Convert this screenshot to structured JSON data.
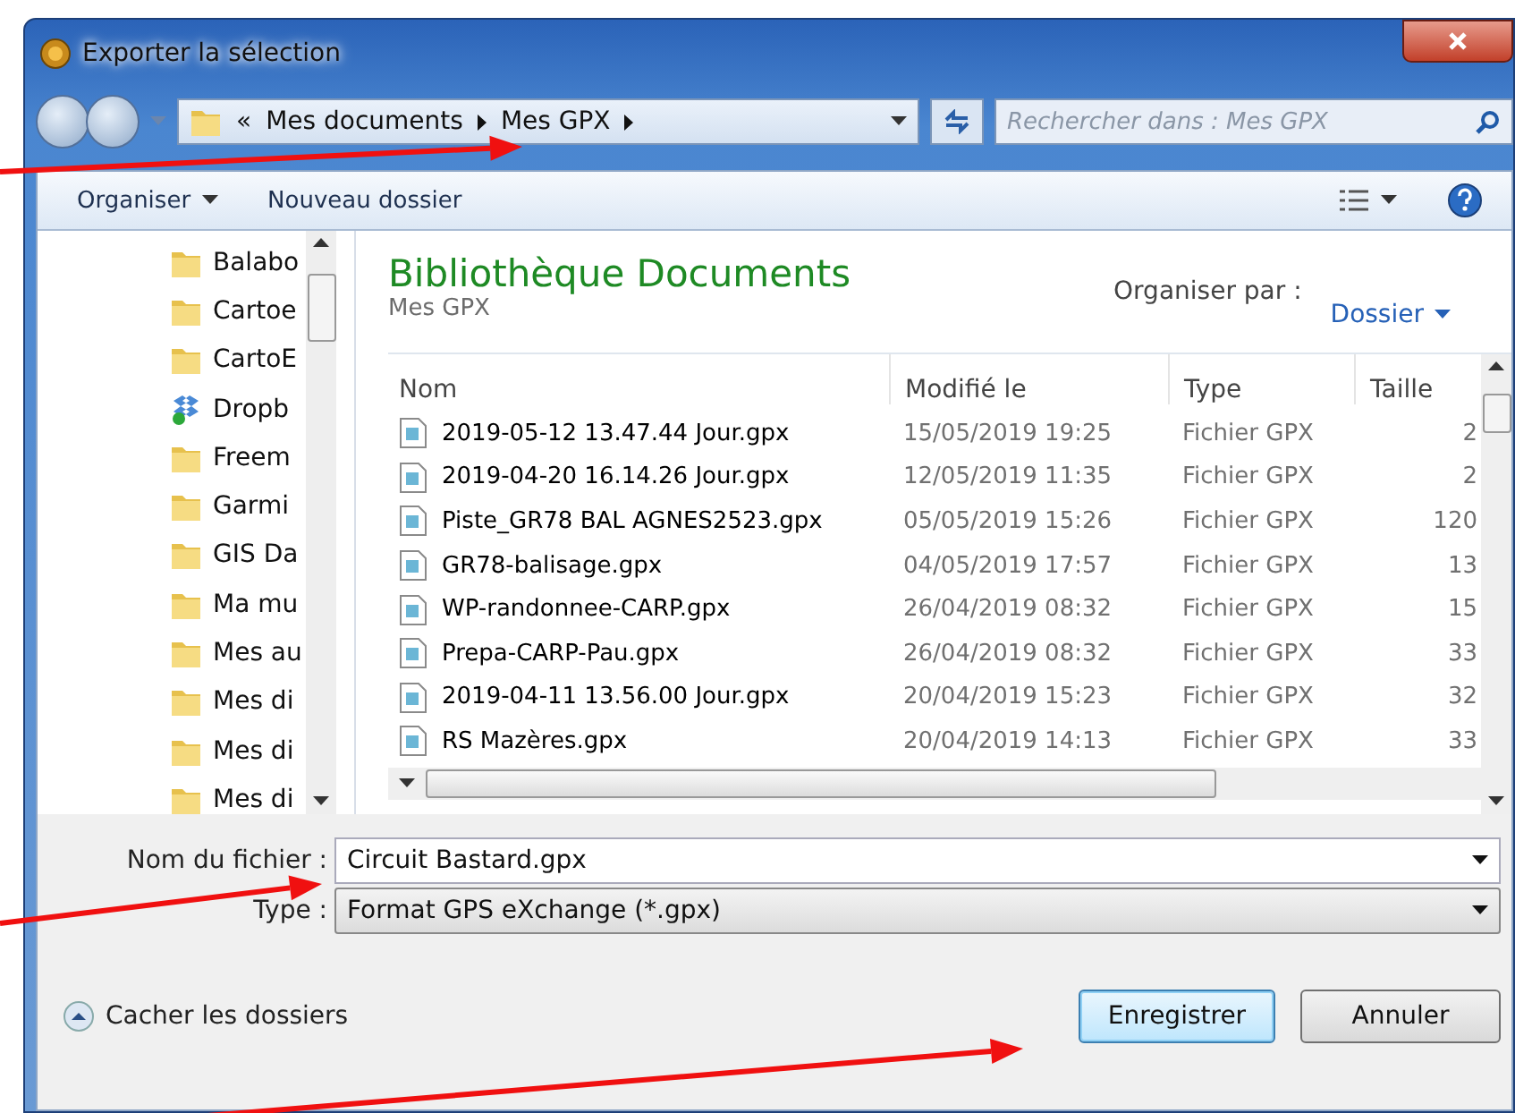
{
  "window": {
    "title": "Exporter la sélection"
  },
  "address_bar": {
    "overflow": "«",
    "crumbs": [
      "Mes documents",
      "Mes GPX"
    ],
    "search_placeholder": "Rechercher dans : Mes GPX"
  },
  "toolbar": {
    "organize": "Organiser",
    "new_folder": "Nouveau dossier"
  },
  "sidebar": {
    "items": [
      {
        "label": "Balabo",
        "kind": "folder"
      },
      {
        "label": "Cartoe",
        "kind": "folder"
      },
      {
        "label": "CartoE",
        "kind": "folder"
      },
      {
        "label": "Dropb",
        "kind": "dropbox"
      },
      {
        "label": "Freem",
        "kind": "folder"
      },
      {
        "label": "Garmi",
        "kind": "folder"
      },
      {
        "label": "GIS Da",
        "kind": "folder"
      },
      {
        "label": "Ma mu",
        "kind": "folder"
      },
      {
        "label": "Mes au",
        "kind": "folder"
      },
      {
        "label": "Mes di",
        "kind": "folder"
      },
      {
        "label": "Mes di",
        "kind": "folder"
      },
      {
        "label": "Mes di",
        "kind": "folder"
      }
    ]
  },
  "library": {
    "title": "Bibliothèque Documents",
    "subtitle": "Mes GPX",
    "arrange_label": "Organiser par :",
    "arrange_value": "Dossier"
  },
  "table": {
    "columns": [
      "Nom",
      "Modifié le",
      "Type",
      "Taille"
    ],
    "rows": [
      [
        "2019-05-12 13.47.44 Jour.gpx",
        "15/05/2019 19:25",
        "Fichier GPX",
        "2"
      ],
      [
        "2019-04-20 16.14.26 Jour.gpx",
        "12/05/2019 11:35",
        "Fichier GPX",
        "2"
      ],
      [
        "Piste_GR78 BAL AGNES2523.gpx",
        "05/05/2019 15:26",
        "Fichier GPX",
        "120"
      ],
      [
        "GR78-balisage.gpx",
        "04/05/2019 17:57",
        "Fichier GPX",
        "13"
      ],
      [
        "WP-randonnee-CARP.gpx",
        "26/04/2019 08:32",
        "Fichier GPX",
        "15"
      ],
      [
        "Prepa-CARP-Pau.gpx",
        "26/04/2019 08:32",
        "Fichier GPX",
        "33"
      ],
      [
        "2019-04-11 13.56.00 Jour.gpx",
        "20/04/2019 15:23",
        "Fichier GPX",
        "32"
      ],
      [
        "RS Mazères.gpx",
        "20/04/2019 14:13",
        "Fichier GPX",
        "33"
      ]
    ]
  },
  "form": {
    "filename_label": "Nom du fichier :",
    "filename": "Circuit Bastard.gpx",
    "type_label": "Type :",
    "type": "Format GPS eXchange (*.gpx)"
  },
  "footer": {
    "hide_folders": "Cacher les dossiers",
    "buttons": [
      {
        "label": "Enregistrer",
        "selected": true
      },
      {
        "label": "Annuler",
        "selected": false
      }
    ]
  }
}
